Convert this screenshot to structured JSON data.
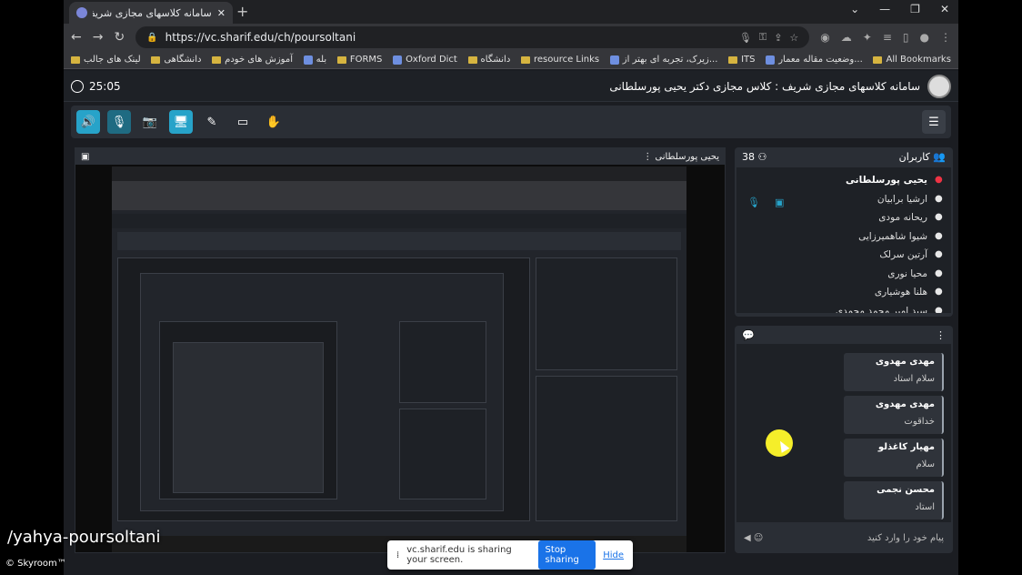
{
  "browser": {
    "tab_title": "سامانه کلاسهای مجازی شریف",
    "url": "https://vc.sharif.edu/ch/poursoltani",
    "bookmarks": [
      "لینک های جالب",
      "دانشگاهی",
      "آموزش های خودم",
      "بله",
      "FORMS",
      "Oxford Dict",
      "دانشگاه",
      "resource Links",
      "زیرک، تجربه ای بهتر از...",
      "ITS",
      "وضعیت مقاله معمار...",
      "All Bookmarks"
    ]
  },
  "app": {
    "clock": "25:05",
    "title": "سامانه کلاسهای مجازی شریف : کلاس مجازی دکتر یحیی پورسلطانی",
    "share_title": "یحیی پورسلطانی"
  },
  "users": {
    "header": "کاربران",
    "count": "38",
    "list": [
      "یحیی پورسلطانی",
      "ارشیا برابیان",
      "ریحانه مودی",
      "شیوا شاهمیرزایی",
      "آرتین سرلک",
      "محیا نوری",
      "هلنا هوشیاری",
      "سید امیر محمد محمدی"
    ]
  },
  "chat": {
    "messages": [
      {
        "name": "مهدی مهدوی",
        "text": "سلام استاد"
      },
      {
        "name": "مهدی مهدوی",
        "text": "خداقوت"
      },
      {
        "name": "مهیار کاغذلو",
        "text": "سلام"
      },
      {
        "name": "محسن نجمی",
        "text": "استاد"
      }
    ],
    "placeholder": "پیام خود را وارد کنید"
  },
  "share_bar": {
    "text": "vc.sharif.edu is sharing your screen.",
    "stop": "Stop sharing",
    "hide": "Hide"
  },
  "watermark": "/yahya-poursoltani",
  "skyroom": "© Skyroom™"
}
